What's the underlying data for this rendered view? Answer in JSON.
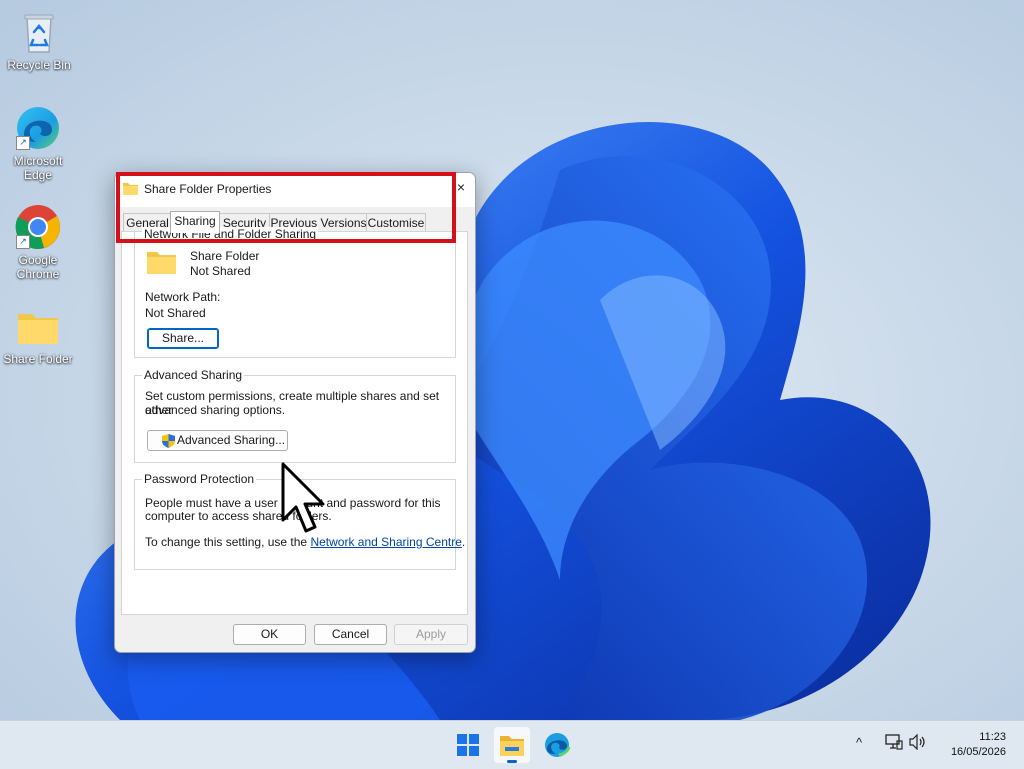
{
  "desktop": {
    "icons": [
      {
        "label_line1": "Recycle Bin",
        "label_line2": "",
        "icon": "recycle-bin-icon"
      },
      {
        "label_line1": "Microsoft",
        "label_line2": "Edge",
        "icon": "edge-icon"
      },
      {
        "label_line1": "Google",
        "label_line2": "Chrome",
        "icon": "chrome-icon"
      },
      {
        "label_line1": "Share Folder",
        "label_line2": "",
        "icon": "folder-icon"
      }
    ]
  },
  "dialog": {
    "title": "Share Folder Properties",
    "close_glyph": "×",
    "tabs": [
      {
        "label": "General",
        "active": false
      },
      {
        "label": "Sharing",
        "active": true
      },
      {
        "label": "Security",
        "active": false
      },
      {
        "label": "Previous Versions",
        "active": false
      },
      {
        "label": "Customise",
        "active": false
      }
    ],
    "network_sharing": {
      "group_title": "Network File and Folder Sharing",
      "folder_name": "Share Folder",
      "share_status": "Not Shared",
      "path_label": "Network Path:",
      "path_value": "Not Shared",
      "share_button": "Share..."
    },
    "advanced_sharing": {
      "group_title": "Advanced Sharing",
      "description_line1": "Set custom permissions, create multiple shares and set other",
      "description_line2": "advanced sharing options.",
      "button": "Advanced Sharing..."
    },
    "password_protection": {
      "group_title": "Password Protection",
      "line1": "People must have a user account and password for this",
      "line2": "computer to access shared folders.",
      "change_prefix": "To change this setting, use the ",
      "change_link": "Network and Sharing Centre",
      "change_suffix": "."
    },
    "buttons": {
      "ok": "OK",
      "cancel": "Cancel",
      "apply": "Apply"
    }
  },
  "taskbar": {
    "time": "11:23",
    "date": "16/05/2026",
    "tray_chevron": "^",
    "colors": {
      "accent": "#0067c0",
      "highlight": "#d4101b"
    }
  }
}
